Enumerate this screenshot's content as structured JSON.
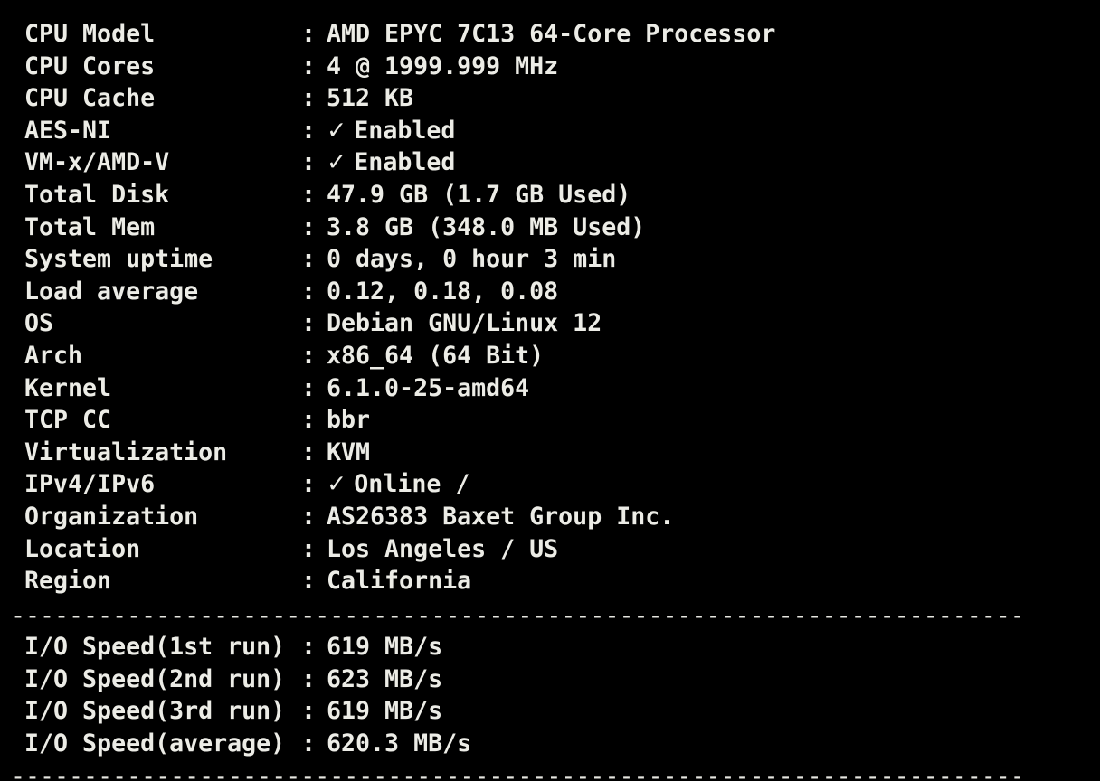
{
  "terminal": {
    "separator": "------------------------------------------------------------------------------------------------------------------------",
    "system_info": [
      {
        "label": "CPU Model",
        "value": "AMD EPYC 7C13 64-Core Processor"
      },
      {
        "label": "CPU Cores",
        "value": "4 @ 1999.999 MHz"
      },
      {
        "label": "CPU Cache",
        "value": "512 KB"
      },
      {
        "label": "AES-NI",
        "check": "✓",
        "value": "Enabled"
      },
      {
        "label": "VM-x/AMD-V",
        "check": "✓",
        "value": "Enabled"
      },
      {
        "label": "Total Disk",
        "value": "47.9 GB (1.7 GB Used)"
      },
      {
        "label": "Total Mem",
        "value": "3.8 GB (348.0 MB Used)"
      },
      {
        "label": "System uptime",
        "value": "0 days, 0 hour 3 min"
      },
      {
        "label": "Load average",
        "value": "0.12, 0.18, 0.08"
      },
      {
        "label": "OS",
        "value": "Debian GNU/Linux 12"
      },
      {
        "label": "Arch",
        "value": "x86_64 (64 Bit)"
      },
      {
        "label": "Kernel",
        "value": "6.1.0-25-amd64"
      },
      {
        "label": "TCP CC",
        "value": "bbr"
      },
      {
        "label": "Virtualization",
        "value": "KVM"
      },
      {
        "label": "IPv4/IPv6",
        "check": "✓",
        "value": "Online /"
      },
      {
        "label": "Organization",
        "value": "AS26383 Baxet Group Inc."
      },
      {
        "label": "Location",
        "value": "Los Angeles / US"
      },
      {
        "label": "Region",
        "value": "California"
      }
    ],
    "io_speed": [
      {
        "label": "I/O Speed(1st run)",
        "value": "619 MB/s"
      },
      {
        "label": "I/O Speed(2nd run)",
        "value": "623 MB/s"
      },
      {
        "label": "I/O Speed(3rd run)",
        "value": "619 MB/s"
      },
      {
        "label": "I/O Speed(average)",
        "value": "620.3 MB/s"
      }
    ],
    "colon": ":",
    "colors": {
      "background": "#000000",
      "text": "#ecece6"
    }
  }
}
